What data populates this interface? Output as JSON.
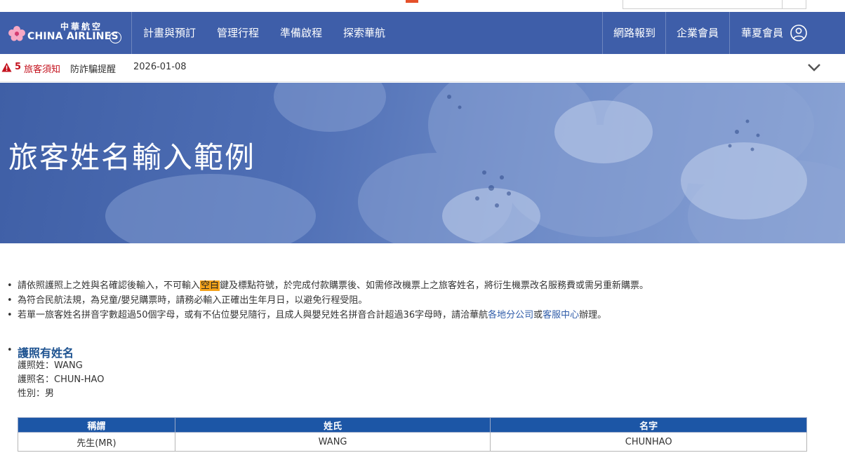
{
  "nav": {
    "logo": {
      "cn": "中華航空",
      "en": "CHINA AIRLINES"
    },
    "items": [
      "計畫與預訂",
      "管理行程",
      "準備啟程",
      "探索華航"
    ],
    "right_items": [
      "網路報到",
      "企業會員",
      "華夏會員"
    ],
    "user_icon": "user-circle-icon",
    "brand_color": "#3e5ea9"
  },
  "notice": {
    "count": "5",
    "title": "旅客須知",
    "link": "防詐騙提醒",
    "date": "2026-01-08",
    "alert_color": "#c4121e"
  },
  "hero": {
    "title": "旅客姓名輸入範例"
  },
  "notes": {
    "line1": {
      "before": "請依照護照上之姓與名確認後輸入，不可輸入",
      "highlight": "空白",
      "after": "鍵及標點符號，於完成付款購票後、如需修改機票上之旅客姓名，將衍生機票改名服務費或需另重新購票。"
    },
    "line2": "為符合民航法規，為兒童/嬰兒購票時，請務必輸入正確出生年月日，以避免行程受阻。",
    "line3": {
      "before": "若單一旅客姓名拼音字數超過50個字母，或有不佔位嬰兒隨行，且成人與嬰兒姓名拼音合計超過36字母時，請洽華航",
      "link1": "各地分公司",
      "mid": "或",
      "link2": "客服中心",
      "after": "辦理。"
    }
  },
  "example": {
    "title": "護照有姓名",
    "surname": "護照姓：WANG",
    "given": "護照名：CHUN-HAO",
    "gender": "性別：男"
  },
  "table": {
    "headers": [
      "稱謂",
      "姓氏",
      "名字"
    ],
    "row": [
      "先生(MR)",
      "WANG",
      "CHUNHAO"
    ],
    "header_color": "#1c56a6"
  }
}
